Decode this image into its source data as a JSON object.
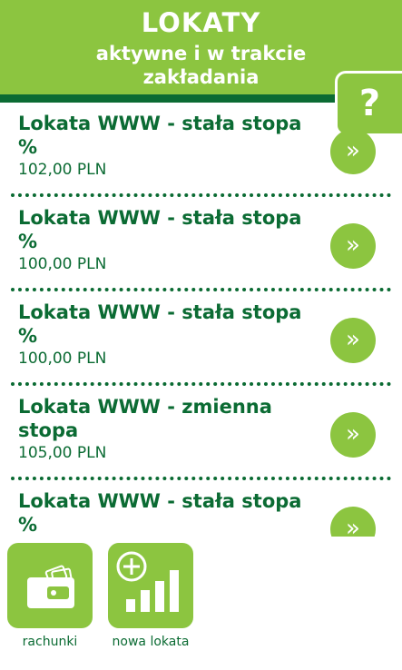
{
  "header": {
    "title": "LOKATY",
    "subtitle": "aktywne i w trakcie zakładania",
    "help_label": "?"
  },
  "deposits": [
    {
      "name": "Lokata WWW - stała stopa %",
      "amount": "102,00 PLN"
    },
    {
      "name": "Lokata WWW - stała stopa %",
      "amount": "100,00 PLN"
    },
    {
      "name": "Lokata WWW - stała stopa %",
      "amount": "100,00 PLN"
    },
    {
      "name": "Lokata WWW - zmienna stopa",
      "amount": "105,00 PLN"
    },
    {
      "name": "Lokata WWW - stała stopa %",
      "amount": ""
    }
  ],
  "arrow_glyph": "»",
  "bottom_nav": {
    "accounts_label": "rachunki",
    "new_deposit_label": "nowa lokata"
  },
  "colors": {
    "accent_green": "#8cc540",
    "dark_green": "#0b6b33"
  }
}
